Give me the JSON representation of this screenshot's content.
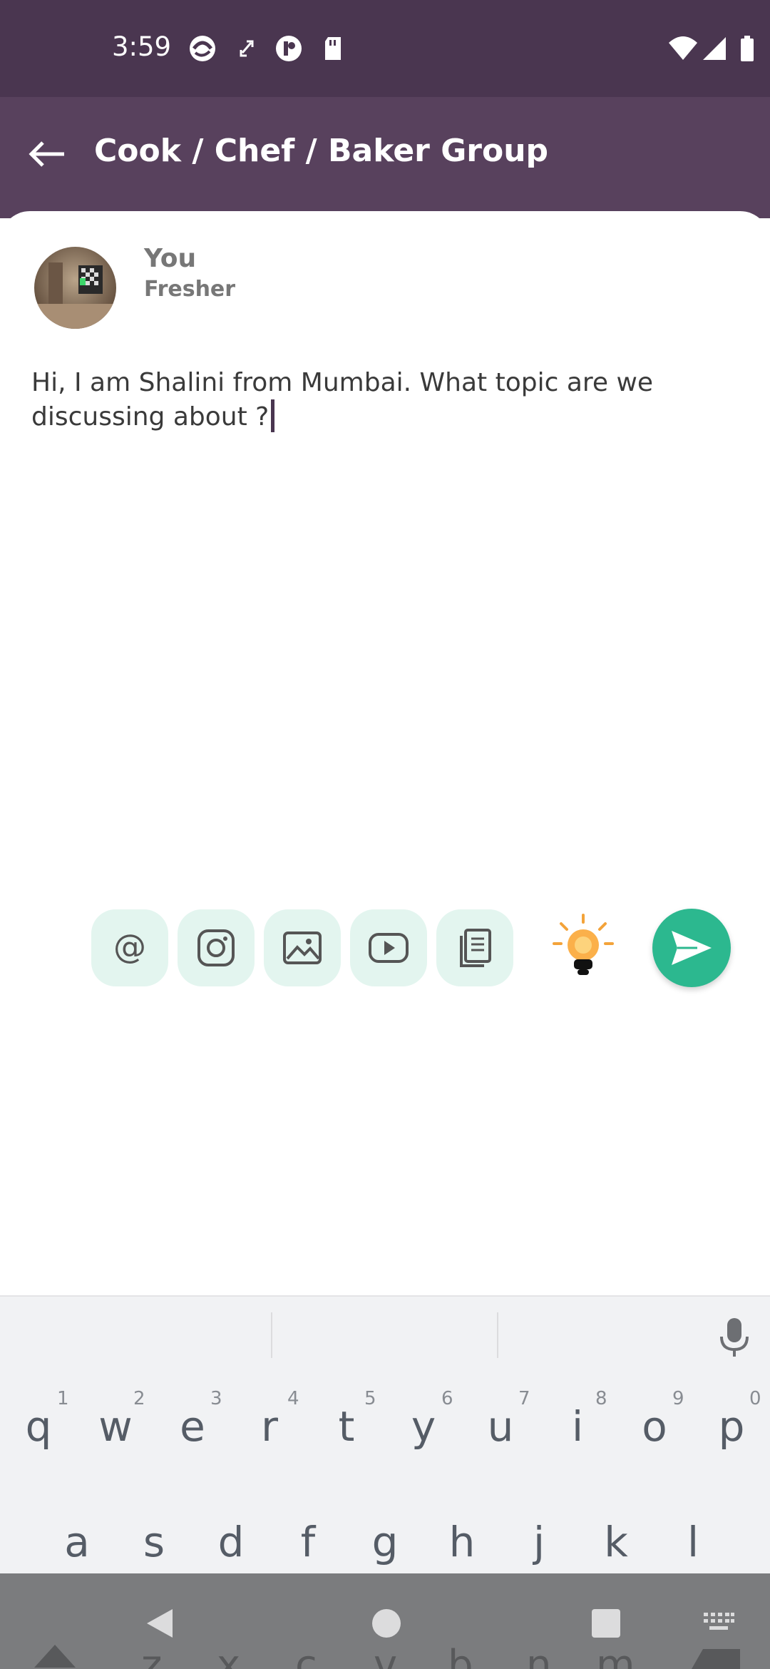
{
  "status_bar": {
    "time": "3:59"
  },
  "header": {
    "title": "Cook / Chef / Baker Group"
  },
  "post": {
    "author_name": "You",
    "author_role": "Fresher",
    "text": "Hi, I am Shalini from Mumbai. What topic are we discussing about ?"
  },
  "toolbar": {
    "tools": [
      {
        "icon": "mention-icon"
      },
      {
        "icon": "instagram-icon"
      },
      {
        "icon": "image-icon"
      },
      {
        "icon": "youtube-icon"
      },
      {
        "icon": "document-icon"
      }
    ],
    "bulb_icon": "lightbulb-icon",
    "send_icon": "send-icon"
  },
  "keyboard": {
    "row1": [
      {
        "key": "q",
        "num": "1"
      },
      {
        "key": "w",
        "num": "2"
      },
      {
        "key": "e",
        "num": "3"
      },
      {
        "key": "r",
        "num": "4"
      },
      {
        "key": "t",
        "num": "5"
      },
      {
        "key": "y",
        "num": "6"
      },
      {
        "key": "u",
        "num": "7"
      },
      {
        "key": "i",
        "num": "8"
      },
      {
        "key": "o",
        "num": "9"
      },
      {
        "key": "p",
        "num": "0"
      }
    ],
    "row2": [
      "a",
      "s",
      "d",
      "f",
      "g",
      "h",
      "j",
      "k",
      "l"
    ],
    "row3": [
      "z",
      "x",
      "c",
      "v",
      "b",
      "n",
      "m"
    ]
  },
  "colors": {
    "status_bar": "#4a3650",
    "header": "#58415d",
    "accent": "#2cb88f",
    "tool_bg": "#e3f5ef",
    "caret": "#4a3650"
  }
}
